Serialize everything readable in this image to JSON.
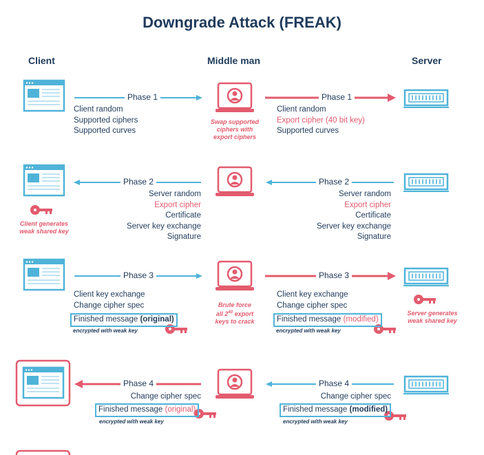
{
  "title": "Downgrade Attack (FREAK)",
  "columns": {
    "client": "Client",
    "middle": "Middle man",
    "server": "Server"
  },
  "phase1": {
    "left_label": "Phase 1",
    "right_label": "Phase 1",
    "client_lines": [
      "Client random",
      "Supported ciphers",
      "Supported curves"
    ],
    "middle_note": [
      "Swap supported",
      "ciphers with",
      "export ciphers"
    ],
    "server_lines": [
      "Client random",
      "Export cipher (40 bit key)",
      "Supported curves"
    ]
  },
  "phase2": {
    "left_label": "Phase 2",
    "right_label": "Phase 2",
    "left_lines": [
      "Server random",
      "Export cipher",
      "Certificate",
      "Server key exchange",
      "Signature"
    ],
    "right_lines": [
      "Server random",
      "Export cipher",
      "Certificate",
      "Server key exchange",
      "Signature"
    ],
    "client_note": [
      "Client generates",
      "weak shared key"
    ]
  },
  "phase3": {
    "left_label": "Phase 3",
    "right_label": "Phase 3",
    "left_lines": [
      "Client key exchange",
      "Change cipher spec"
    ],
    "left_finished_prefix": "Finished message ",
    "left_finished_suffix": "(original)",
    "left_encrypted": "encrypted with weak key",
    "middle_note_1": "Brute force",
    "middle_note_2a": "all 2",
    "middle_note_2sup": "40",
    "middle_note_2b": " export",
    "middle_note_3": "keys to crack",
    "right_lines": [
      "Client key exchange",
      "Change cipher spec"
    ],
    "right_finished_prefix": "Finished message ",
    "right_finished_suffix": "(modified)",
    "right_encrypted": "encrypted with weak key",
    "server_note": [
      "Server generates",
      "weak shared key"
    ]
  },
  "phase4": {
    "left_label": "Phase 4",
    "right_label": "Phase 4",
    "left_line": "Change cipher spec",
    "left_finished_prefix": "Finished message ",
    "left_finished_suffix": "(original)",
    "left_encrypted": "encrypted with weak key",
    "right_line": "Change cipher spec",
    "right_finished_prefix": "Finished message ",
    "right_finished_suffix": "(modified)",
    "right_encrypted": "encrypted with weak key"
  },
  "colors": {
    "blue": "#4fb3d9",
    "red": "#e35b6e",
    "navy": "#1f3b5c"
  }
}
